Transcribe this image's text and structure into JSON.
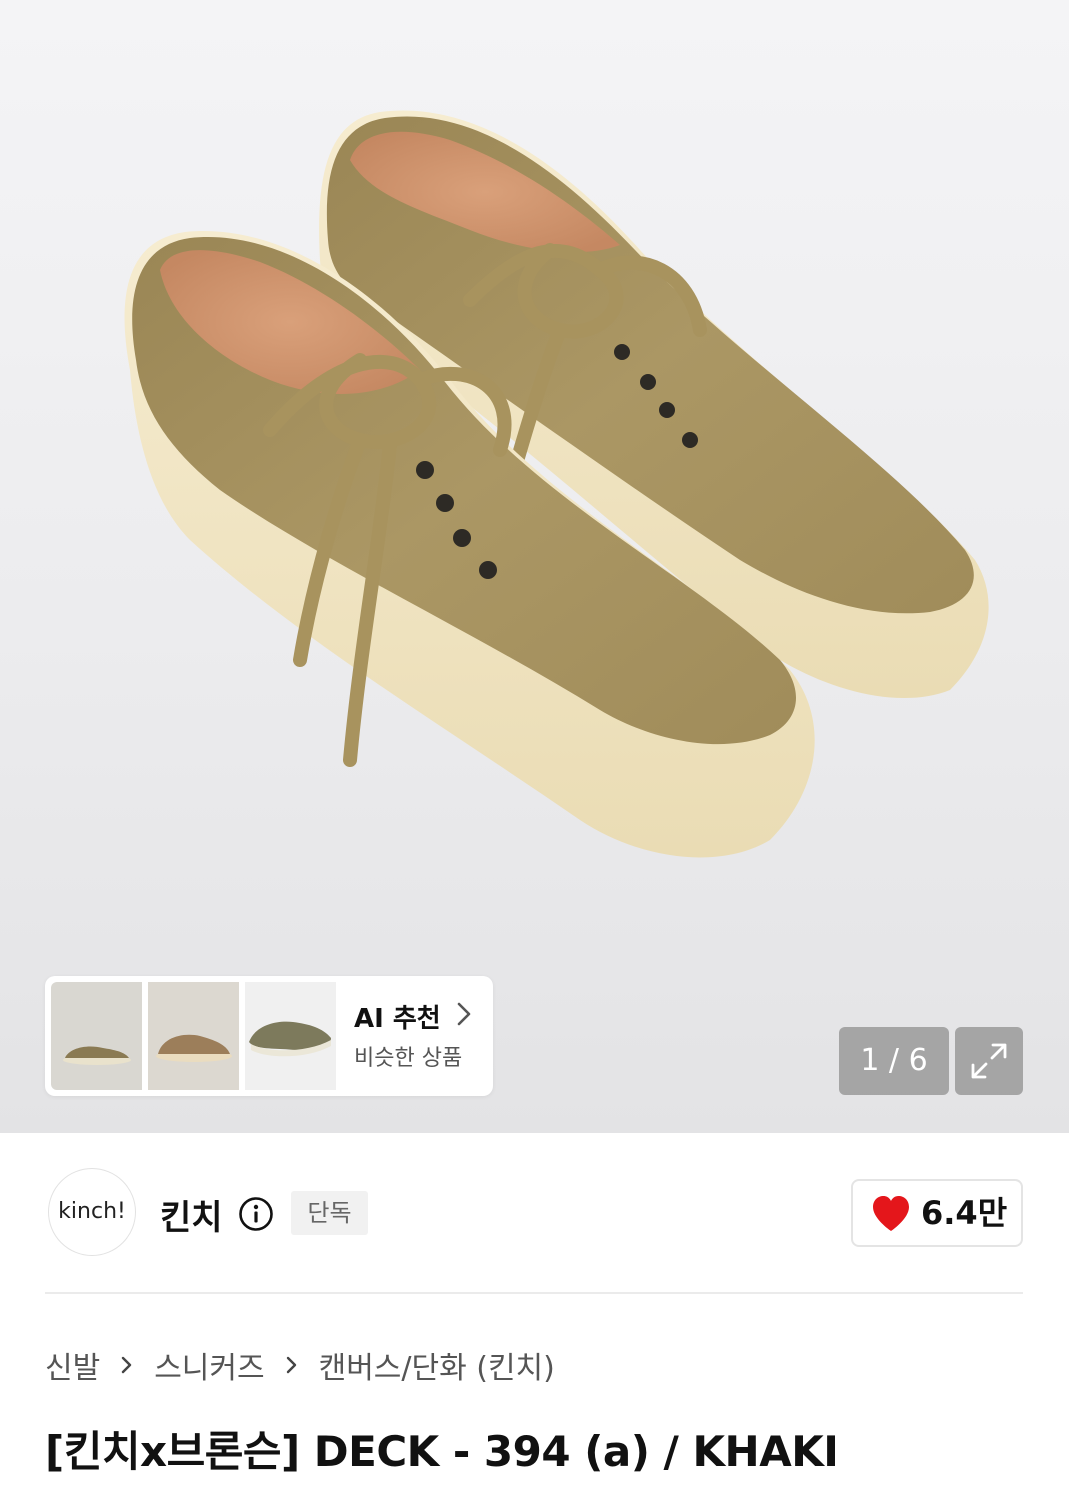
{
  "gallery": {
    "counter": "1 / 6",
    "ai_recommend": {
      "label": "AI 추천",
      "sub_label": "비슷한 상품"
    }
  },
  "brand": {
    "logo_text": "kinch!",
    "name": "킨치",
    "badge": "단독",
    "like_count": "6.4만",
    "like_color": "#e4161b"
  },
  "breadcrumb": [
    "신발",
    "스니커즈",
    "캔버스/단화 (킨치)"
  ],
  "product": {
    "title": "[킨치x브론슨] DECK - 394 (a) / KHAKI",
    "color_name": "KHAKI",
    "upper_color": "#a89462",
    "sole_color": "#f3e8c8"
  }
}
